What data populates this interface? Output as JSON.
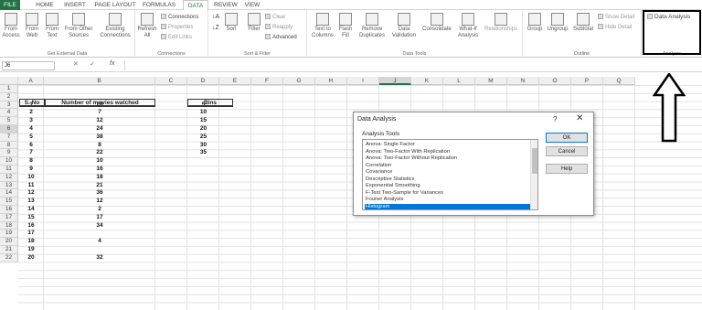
{
  "tabs": [
    "FILE",
    "HOME",
    "INSERT",
    "PAGE LAYOUT",
    "FORMULAS",
    "DATA",
    "REVIEW",
    "VIEW"
  ],
  "active_tab": "DATA",
  "ribbon": {
    "get_external": {
      "label": "Get External Data",
      "from_access": "From Access",
      "from_web": "From Web",
      "from_text": "From Text",
      "from_other": "From Other Sources",
      "existing": "Existing Connections"
    },
    "connections": {
      "label": "Connections",
      "refresh": "Refresh All",
      "connections": "Connections",
      "properties": "Properties",
      "edit_links": "Edit Links"
    },
    "sort_filter": {
      "label": "Sort & Filter",
      "sort": "Sort",
      "filter": "Filter",
      "clear": "Clear",
      "reapply": "Reapply",
      "advanced": "Advanced"
    },
    "data_tools": {
      "label": "Data Tools",
      "text_to_columns": "Text to Columns",
      "flash_fill": "Flash Fill",
      "remove_dup": "Remove Duplicates",
      "validation": "Data Validation",
      "consolidate": "Consolidate",
      "what_if": "What-If Analysis",
      "relationships": "Relationships"
    },
    "outline": {
      "label": "Outline",
      "group": "Group",
      "ungroup": "Ungroup",
      "subtotal": "Subtotal",
      "show_detail": "Show Detail",
      "hide_detail": "Hide Detail"
    },
    "analysis": {
      "label": "Analysis",
      "data_analysis": "Data Analysis"
    }
  },
  "formula_bar": {
    "name_box": "J6",
    "fx": "fx"
  },
  "columns": [
    "A",
    "B",
    "C",
    "D",
    "E",
    "F",
    "G",
    "H",
    "I",
    "J",
    "K",
    "L",
    "M",
    "N",
    "O",
    "P",
    "Q"
  ],
  "rows": [
    "1",
    "2",
    "3",
    "4",
    "5",
    "6",
    "7",
    "8",
    "9",
    "10",
    "11",
    "12",
    "13",
    "14",
    "15",
    "16",
    "17",
    "18",
    "19",
    "20",
    "21",
    "22"
  ],
  "sheet": {
    "headers": {
      "sno": "S. No",
      "movies": "Number of movies watched",
      "bins": "Bins"
    },
    "sno": [
      "1",
      "2",
      "3",
      "4",
      "5",
      "6",
      "7",
      "8",
      "9",
      "10",
      "11",
      "12",
      "13",
      "14",
      "15",
      "16",
      "17",
      "18",
      "19",
      "20"
    ],
    "movies": [
      "28",
      "7",
      "12",
      "24",
      "38",
      "8",
      "22",
      "10",
      "16",
      "18",
      "21",
      "36",
      "12",
      "2",
      "17",
      "34",
      "4",
      "32"
    ],
    "movies_rows": [
      3,
      4,
      5,
      6,
      7,
      8,
      9,
      10,
      11,
      12,
      13,
      14,
      15,
      16,
      17,
      18,
      20,
      22
    ],
    "bins": [
      "5",
      "10",
      "15",
      "20",
      "25",
      "30",
      "35"
    ]
  },
  "dialog": {
    "title": "Data Analysis",
    "help_q": "?",
    "close": "✕",
    "list_label": "Analysis Tools",
    "items": [
      "Anova: Single Factor",
      "Anova: Two-Factor With Replication",
      "Anova: Two-Factor Without Replication",
      "Correlation",
      "Covariance",
      "Descriptive Statistics",
      "Exponential Smoothing",
      "F-Test Two-Sample for Variances",
      "Fourier Analysis",
      "Histogram"
    ],
    "selected": "Histogram",
    "ok": "OK",
    "cancel": "Cancel",
    "help": "Help"
  }
}
